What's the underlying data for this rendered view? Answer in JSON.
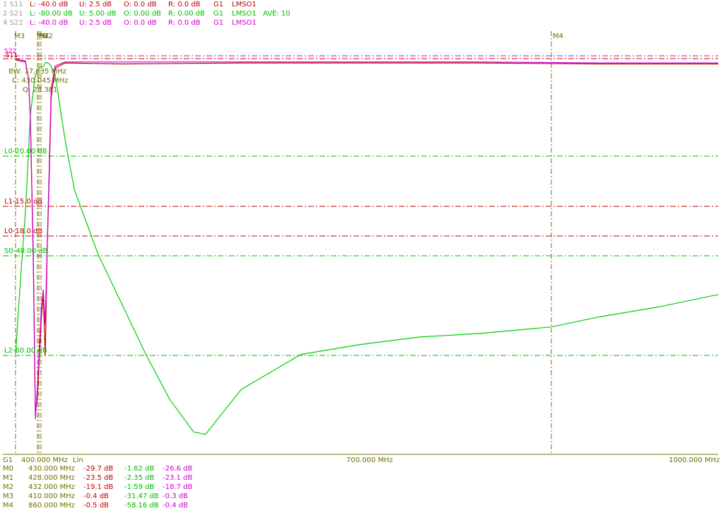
{
  "colors": {
    "s11": "#c00000",
    "s21": "#00cc00",
    "s22": "#d000d0",
    "marker": "#707000",
    "axis": "#707000",
    "grey": "#a0a0a0"
  },
  "header": [
    {
      "id": "1 S11",
      "L": "L: -40.0 dB",
      "U": "U: 2.5 dB",
      "O": "O: 0.0 dB",
      "R": "R: 0.0 dB",
      "G": "G1",
      "mode": "LMSO1",
      "extra": ""
    },
    {
      "id": "2 S21",
      "L": "L: -80.00 dB",
      "U": "U: 5.00 dB",
      "O": "O: 0.00 dB",
      "R": "R: 0.00 dB",
      "G": "G1",
      "mode": "LMSO1",
      "extra": "AVE: 10"
    },
    {
      "id": "4 S22",
      "L": "L: -40.0 dB",
      "U": "U: 2.5 dB",
      "O": "O: 0.0 dB",
      "R": "R: 0.0 dB",
      "G": "G1",
      "mode": "LMSO1",
      "extra": ""
    }
  ],
  "trace_labels": {
    "s22": "S22",
    "s11": "S11"
  },
  "markers_top": [
    "M3",
    "M0",
    "M1",
    "M2",
    "M4"
  ],
  "filter_info": {
    "bw": "BW: 17.635 MHz",
    "center": "C: 430.045 MHz",
    "q": "Q: 24.381"
  },
  "limit_labels": [
    {
      "text": "L0-20.00 dB",
      "color": "#00bb00"
    },
    {
      "text": "L1-15.0 dB",
      "color": "#c00000"
    },
    {
      "text": "L0-18.0 dB",
      "color": "#c00000"
    },
    {
      "text": "S0-40.00 dB",
      "color": "#00bb00"
    },
    {
      "text": "L2-60.00 dB",
      "color": "#00bb00"
    }
  ],
  "axis": {
    "group": "G1",
    "start": "400.000 MHz",
    "scale": "Lin",
    "mid": "700.000 MHz",
    "end": "1000.000 MHz"
  },
  "marker_table": [
    {
      "name": "M0",
      "freq": "430.000 MHz",
      "s11": "-29.7 dB",
      "s21": "-1.62 dB",
      "s22": "-26.6 dB"
    },
    {
      "name": "M1",
      "freq": "428.000 MHz",
      "s11": "-23.5 dB",
      "s21": "-2.35 dB",
      "s22": "-23.1 dB"
    },
    {
      "name": "M2",
      "freq": "432.000 MHz",
      "s11": "-19.1 dB",
      "s21": "-1.59 dB",
      "s22": "-18.7 dB"
    },
    {
      "name": "M3",
      "freq": "410.000 MHz",
      "s11": "-0.4 dB",
      "s21": "-31.47 dB",
      "s22": "-0.3 dB"
    },
    {
      "name": "M4",
      "freq": "860.000 MHz",
      "s11": "-0.5 dB",
      "s21": "-58.16 dB",
      "s22": "-0.4 dB"
    }
  ],
  "chart_data": {
    "type": "line",
    "xlabel": "",
    "ylabel": "",
    "x_unit": "MHz",
    "xlim": [
      400,
      1000
    ],
    "series": [
      {
        "name": "S11",
        "ref": "upper",
        "x": [
          400,
          405,
          410,
          413,
          415,
          418,
          420,
          422,
          424,
          426,
          428,
          430,
          432,
          434,
          436,
          440,
          450,
          500,
          600,
          700,
          800,
          900,
          1000
        ],
        "y": [
          -0.2,
          -0.3,
          -0.4,
          -2,
          -6,
          -20,
          -35,
          -34,
          -30,
          -26,
          -23.5,
          -29.7,
          -19.1,
          -12,
          -4,
          -1,
          -0.5,
          -0.6,
          -0.5,
          -0.5,
          -0.5,
          -0.6,
          -0.6
        ]
      },
      {
        "name": "S21",
        "ref": "lower",
        "x": [
          400,
          405,
          410,
          415,
          420,
          425,
          428,
          430,
          432,
          435,
          440,
          450,
          460,
          480,
          500,
          520,
          540,
          560,
          570,
          580,
          600,
          650,
          700,
          750,
          800,
          860,
          900,
          950,
          1000
        ],
        "y": [
          -60,
          -45,
          -31.47,
          -12,
          -4,
          -2.5,
          -2.35,
          -1.62,
          -1.59,
          -2,
          -4,
          -17,
          -27,
          -40,
          -50,
          -60,
          -69,
          -75.5,
          -76,
          -73,
          -67,
          -60,
          -58,
          -56.5,
          -55.8,
          -54.5,
          -52.5,
          -50.5,
          -48
        ]
      },
      {
        "name": "S22",
        "ref": "upper",
        "x": [
          400,
          405,
          410,
          413,
          415,
          418,
          420,
          422,
          424,
          426,
          428,
          430,
          432,
          434,
          436,
          440,
          450,
          500,
          600,
          700,
          800,
          900,
          1000
        ],
        "y": [
          -0.1,
          -0.2,
          -0.3,
          -2,
          -6,
          -21,
          -36,
          -33,
          -29,
          -25,
          -23.1,
          -26.6,
          -18.7,
          -11,
          -3,
          -0.8,
          -0.4,
          -0.4,
          -0.4,
          -0.4,
          -0.4,
          -0.5,
          -0.5
        ]
      }
    ],
    "limit_lines": [
      {
        "label": "L0-20.00 dB",
        "value": -20
      },
      {
        "label": "L1-15.0 dB",
        "value": -15
      },
      {
        "label": "L0-18.0 dB",
        "value": -18
      },
      {
        "label": "S0-40.00 dB",
        "value": -40
      },
      {
        "label": "L2-60.00 dB",
        "value": -60
      }
    ],
    "markers": [
      {
        "name": "M0",
        "x": 430
      },
      {
        "name": "M1",
        "x": 428
      },
      {
        "name": "M2",
        "x": 432
      },
      {
        "name": "M3",
        "x": 410
      },
      {
        "name": "M4",
        "x": 860
      }
    ]
  }
}
